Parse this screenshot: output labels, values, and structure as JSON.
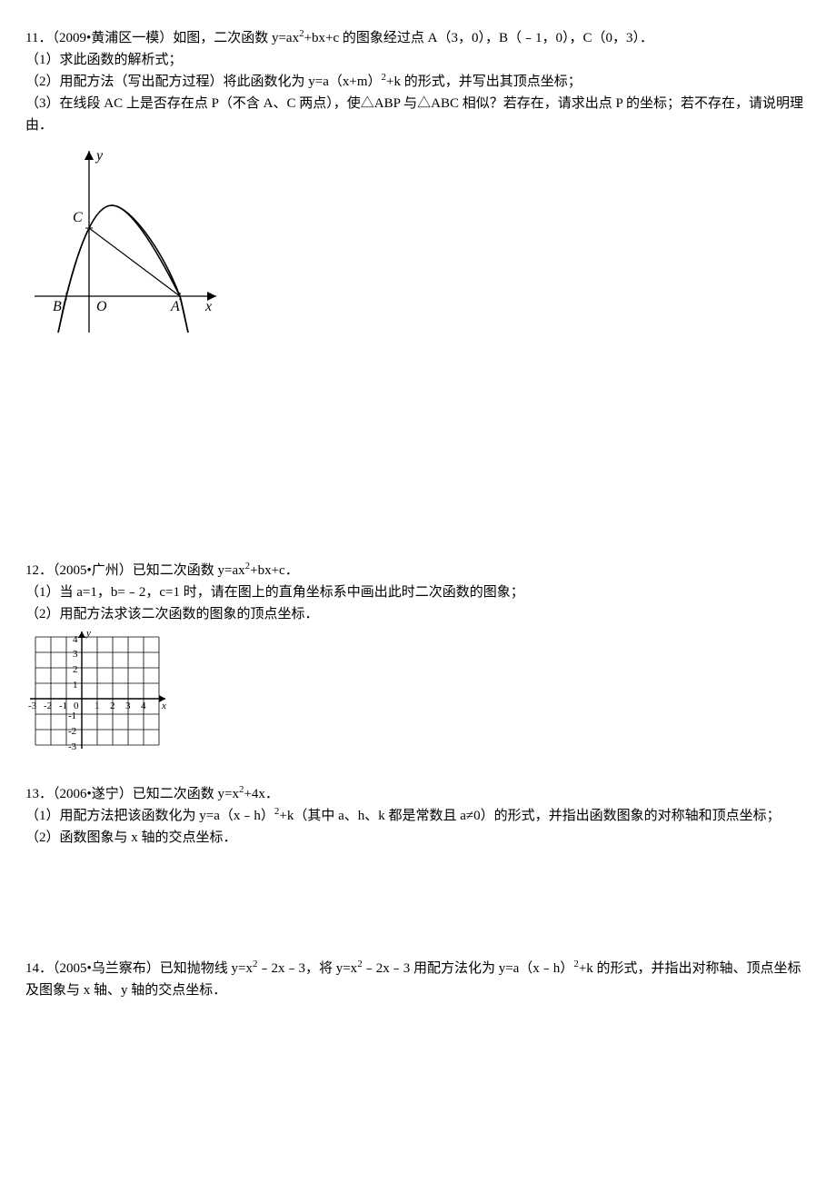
{
  "problems": {
    "p11": {
      "l1a": "11．（2009•黄浦区一模）如图，二次函数 y=ax",
      "l1b": "+bx+c 的图象经过点 A（3，0），B（﹣1，0），C（0，3）．",
      "l2": "（1）求此函数的解析式；",
      "l3a": "（2）用配方法（写出配方过程）将此函数化为 y=a（x+m）",
      "l3b": "+k 的形式，并写出其顶点坐标；",
      "l4": "（3）在线段 AC 上是否存在点 P（不含 A、C 两点），使△ABP 与△ABC 相似？若存在，请求出点 P 的坐标；若不存在，请说明理由．",
      "fig": {
        "y": "y",
        "x": "x",
        "O": "O",
        "A": "A",
        "B": "B",
        "C": "C"
      }
    },
    "p12": {
      "l1a": "12．（2005•广州）已知二次函数 y=ax",
      "l1b": "+bx+c．",
      "l2": "（1）当 a=1，b=﹣2，c=1 时，请在图上的直角坐标系中画出此时二次函数的图象；",
      "l3": "（2）用配方法求该二次函数的图象的顶点坐标．",
      "fig": {
        "ylabel": "y",
        "xlabel": "x",
        "xneg": [
          "-3",
          "-2",
          "-1"
        ],
        "xpos": [
          "1",
          "2",
          "3",
          "4"
        ],
        "ypos": [
          "4",
          "3",
          "2",
          "1"
        ],
        "yneg": [
          "-1",
          "-2",
          "-3"
        ],
        "zero": "0"
      }
    },
    "p13": {
      "l1a": "13．（2006•遂宁）已知二次函数 y=x",
      "l1b": "+4x．",
      "l2a": "（1）用配方法把该函数化为 y=a（x﹣h）",
      "l2b": "+k（其中 a、h、k 都是常数且 a≠0）的形式，并指出函数图象的对称轴和顶点坐标；",
      "l3": "（2）函数图象与 x 轴的交点坐标．"
    },
    "p14": {
      "l1a": "14．（2005•乌兰察布）已知抛物线 y=x",
      "l1b": "﹣2x﹣3，将 y=x",
      "l1c": "﹣2x﹣3 用配方法化为 y=a（x﹣h）",
      "l1d": "+k 的形式，并指出对称轴、顶点坐标及图象与 x 轴、y 轴的交点坐标．"
    }
  }
}
